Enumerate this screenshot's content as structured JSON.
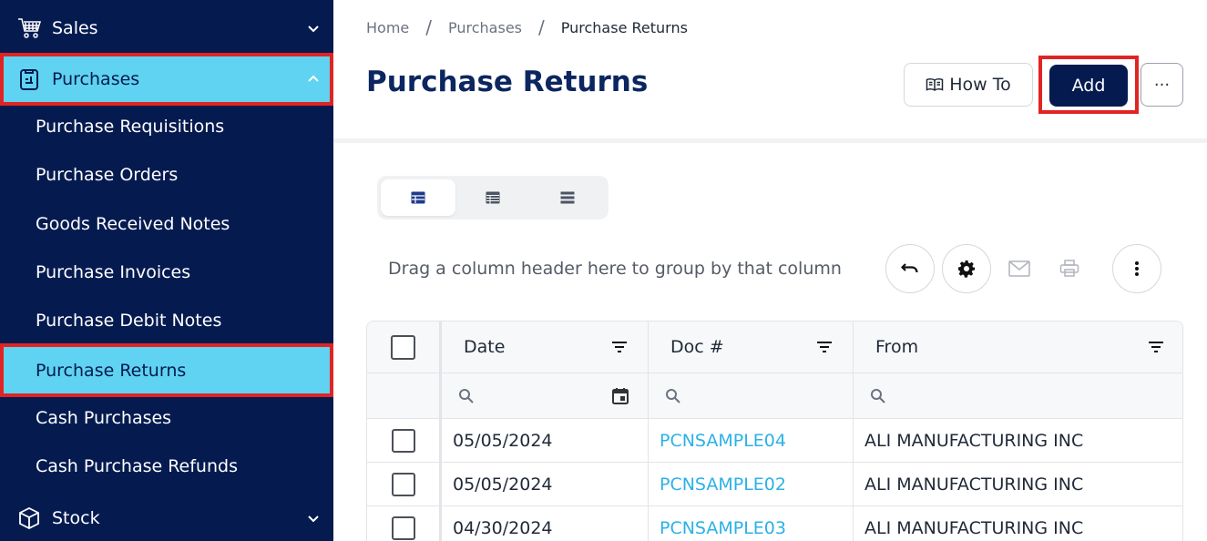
{
  "sidebar": {
    "sales_label": "Sales",
    "purchases_label": "Purchases",
    "stock_label": "Stock",
    "purchase_items": [
      {
        "label": "Purchase Requisitions"
      },
      {
        "label": "Purchase Orders"
      },
      {
        "label": "Goods Received Notes"
      },
      {
        "label": "Purchase Invoices"
      },
      {
        "label": "Purchase Debit Notes"
      },
      {
        "label": "Purchase Returns"
      },
      {
        "label": "Cash Purchases"
      },
      {
        "label": "Cash Purchase Refunds"
      }
    ],
    "icons": {
      "sales": "cart-icon",
      "purchases": "clipboard-icon",
      "stock": "box-icon"
    }
  },
  "breadcrumb": {
    "items": [
      "Home",
      "Purchases",
      "Purchase Returns"
    ],
    "separator": "/"
  },
  "header": {
    "title": "Purchase Returns",
    "howto_label": "How To",
    "add_label": "Add",
    "more_label": "···"
  },
  "toolbar": {
    "group_hint": "Drag a column header here to group by that column",
    "icons": [
      "undo-icon",
      "gear-icon",
      "mail-icon",
      "print-icon",
      "more-vertical-icon"
    ]
  },
  "grid": {
    "columns": [
      "Date",
      "Doc #",
      "From"
    ],
    "rows": [
      {
        "date": "05/05/2024",
        "doc": "PCNSAMPLE04",
        "from": "ALI MANUFACTURING INC"
      },
      {
        "date": "05/05/2024",
        "doc": "PCNSAMPLE02",
        "from": "ALI MANUFACTURING INC"
      },
      {
        "date": "04/30/2024",
        "doc": "PCNSAMPLE03",
        "from": "ALI MANUFACTURING INC"
      }
    ]
  },
  "colors": {
    "sidebar_bg": "#051b50",
    "active_bg": "#5fd3f1",
    "highlight_border": "#e02424",
    "title": "#0b2660",
    "link": "#2bb1e8"
  }
}
